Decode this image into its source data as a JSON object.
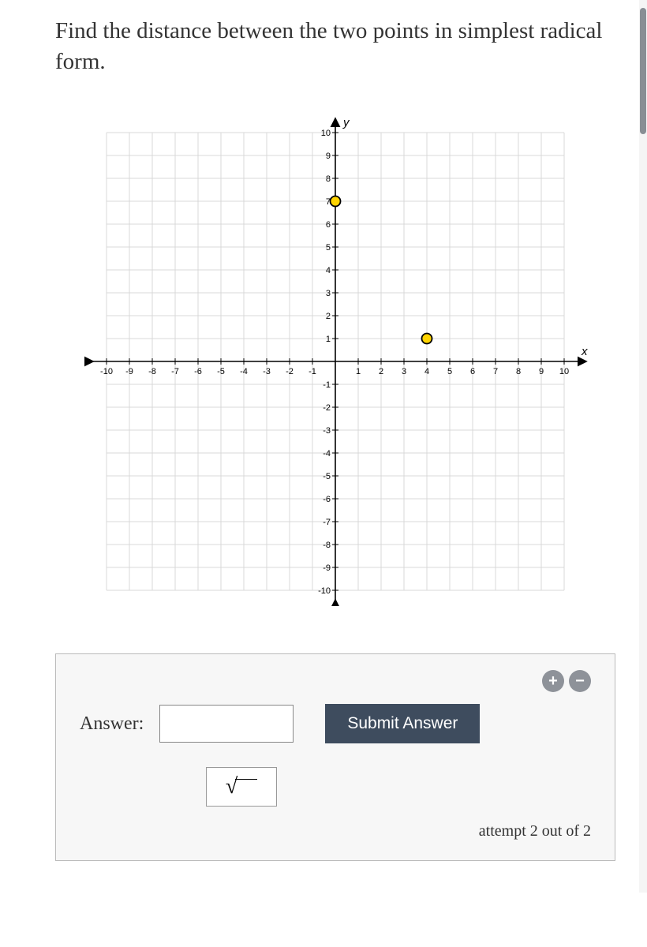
{
  "question": "Find the distance between the two points in simplest radical form.",
  "answer_label": "Answer:",
  "submit_label": "Submit Answer",
  "attempt_text": "attempt 2 out of 2",
  "sqrt_symbol": "√",
  "plus_label": "+",
  "minus_label": "−",
  "chart_data": {
    "type": "scatter",
    "title": "",
    "xlabel": "x",
    "ylabel": "y",
    "xlim": [
      -10,
      10
    ],
    "ylim": [
      -10,
      10
    ],
    "x_ticks": [
      -10,
      -9,
      -8,
      -7,
      -6,
      -5,
      -4,
      -3,
      -2,
      -1,
      1,
      2,
      3,
      4,
      5,
      6,
      7,
      8,
      9,
      10
    ],
    "y_ticks": [
      10,
      9,
      8,
      7,
      6,
      5,
      4,
      3,
      2,
      1,
      -1,
      -2,
      -3,
      -4,
      -5,
      -6,
      -7,
      -8,
      -9,
      -10
    ],
    "series": [
      {
        "name": "points",
        "values": [
          [
            0,
            7
          ],
          [
            4,
            1
          ]
        ]
      }
    ]
  }
}
